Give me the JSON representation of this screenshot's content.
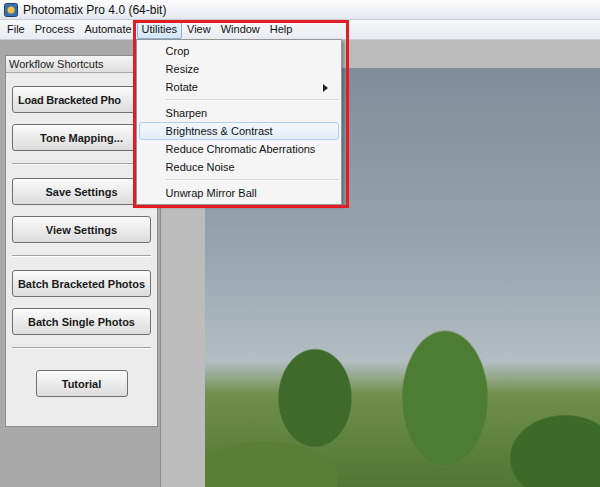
{
  "window": {
    "title": "Photomatix Pro 4.0 (64-bit)"
  },
  "menu_bar": [
    {
      "label": "File",
      "selected": false
    },
    {
      "label": "Process",
      "selected": false
    },
    {
      "label": "Automate",
      "selected": false
    },
    {
      "label": "Utilities",
      "selected": true
    },
    {
      "label": "View",
      "selected": false
    },
    {
      "label": "Window",
      "selected": false
    },
    {
      "label": "Help",
      "selected": false
    }
  ],
  "dropdown": {
    "items": [
      {
        "kind": "item",
        "label": "Crop",
        "selected": false,
        "submenu": false
      },
      {
        "kind": "item",
        "label": "Resize",
        "selected": false,
        "submenu": false
      },
      {
        "kind": "item",
        "label": "Rotate",
        "selected": false,
        "submenu": true
      },
      {
        "kind": "separator"
      },
      {
        "kind": "item",
        "label": "Sharpen",
        "selected": false,
        "submenu": false
      },
      {
        "kind": "item",
        "label": "Brightness & Contrast",
        "selected": true,
        "submenu": false
      },
      {
        "kind": "item",
        "label": "Reduce Chromatic Aberrations",
        "selected": false,
        "submenu": false
      },
      {
        "kind": "item",
        "label": "Reduce Noise",
        "selected": false,
        "submenu": false
      },
      {
        "kind": "separator"
      },
      {
        "kind": "item",
        "label": "Unwrap Mirror Ball",
        "selected": false,
        "submenu": false
      }
    ]
  },
  "shortcuts": {
    "title": "Workflow Shortcuts",
    "groups": [
      {
        "buttons": [
          {
            "label": "Load Bracketed Pho",
            "kind": "clipped"
          },
          {
            "label": "Tone Mapping...",
            "kind": "wide"
          }
        ]
      },
      {
        "buttons": [
          {
            "label": "Save Settings",
            "kind": "wide"
          },
          {
            "label": "View Settings",
            "kind": "wide"
          }
        ]
      },
      {
        "buttons": [
          {
            "label": "Batch Bracketed Photos",
            "kind": "wide"
          },
          {
            "label": "Batch Single Photos",
            "kind": "wide"
          }
        ]
      },
      {
        "buttons": [
          {
            "label": "Tutorial",
            "kind": "compact"
          }
        ]
      }
    ]
  }
}
